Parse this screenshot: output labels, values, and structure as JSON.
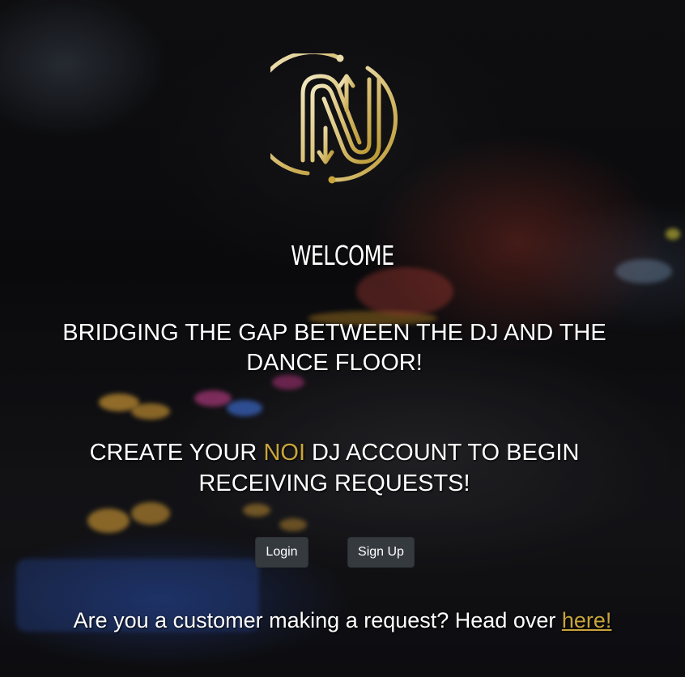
{
  "colors": {
    "accent_gold": "#c9a53a",
    "button_bg": "#353a3f",
    "text": "#ffffff"
  },
  "logo": {
    "icon": "noi-n-monogram-logo"
  },
  "hero": {
    "welcome": "WELCOME",
    "tagline": "BRIDGING THE GAP BETWEEN THE DJ AND THE DANCE FLOOR!",
    "create_prefix": "CREATE YOUR ",
    "create_brand": "NOI",
    "create_suffix": " DJ ACCOUNT TO BEGIN RECEIVING REQUESTS!"
  },
  "actions": {
    "login_label": "Login",
    "signup_label": "Sign Up"
  },
  "customer": {
    "prompt": "Are you a customer making a request? Head over ",
    "link_label": "here!"
  }
}
